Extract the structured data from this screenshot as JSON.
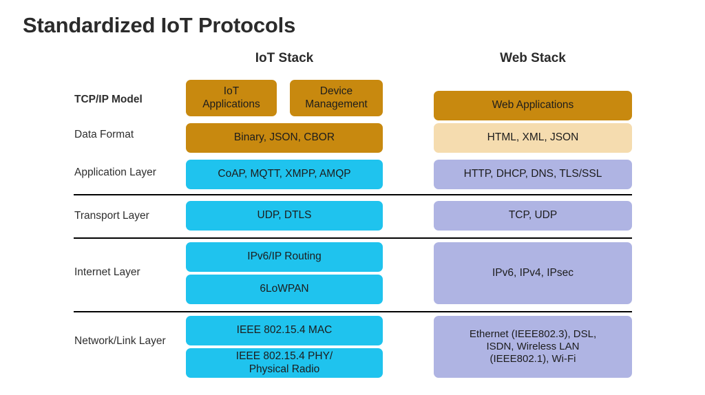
{
  "title": "Standardized IoT Protocols",
  "columns": {
    "iot": "IoT Stack",
    "web": "Web Stack"
  },
  "colors": {
    "orange": "#C8890F",
    "cyan": "#1FC3EE",
    "periwinkle": "#AFB4E3",
    "tan": "#F5DCAF",
    "text": "#1c1c1c",
    "title": "#2b2b2b",
    "divider": "#000000",
    "background": "#ffffff"
  },
  "rows": [
    {
      "label": "TCP/IP Model",
      "iot": [
        "IoT Applications",
        "Device Management"
      ],
      "web": [
        "Web Applications"
      ]
    },
    {
      "label": "Data Format",
      "iot": [
        "Binary, JSON, CBOR"
      ],
      "web": [
        "HTML, XML, JSON"
      ]
    },
    {
      "label": "Application Layer",
      "iot": [
        "CoAP, MQTT, XMPP, AMQP"
      ],
      "web": [
        "HTTP, DHCP, DNS, TLS/SSL"
      ]
    },
    {
      "label": "Transport Layer",
      "iot": [
        "UDP, DTLS"
      ],
      "web": [
        "TCP, UDP"
      ]
    },
    {
      "label": "Internet Layer",
      "iot": [
        "IPv6/IP Routing",
        "6LoWPAN"
      ],
      "web": [
        "IPv6, IPv4, IPsec"
      ]
    },
    {
      "label": "Network/Link Layer",
      "iot": [
        "IEEE 802.15.4 MAC",
        "IEEE 802.15.4 PHY/ Physical Radio"
      ],
      "web": [
        "Ethernet (IEEE802.3), DSL, ISDN, Wireless LAN (IEEE802.1), Wi-Fi"
      ]
    }
  ],
  "box_text": {
    "iot_applications": "IoT\nApplications",
    "device_management": "Device\nManagement",
    "binary_json_cbor": "Binary, JSON, CBOR",
    "coap_mqtt_xmpp_amqp": "CoAP, MQTT, XMPP, AMQP",
    "udp_dtls": "UDP, DTLS",
    "ipv6_ip_routing": "IPv6/IP Routing",
    "sixlowpan": "6LoWPAN",
    "ieee_mac": "IEEE 802.15.4 MAC",
    "ieee_phy": "IEEE 802.15.4 PHY/\nPhysical Radio",
    "web_applications": "Web Applications",
    "html_xml_json": "HTML, XML, JSON",
    "http_dhcp_dns_tls": "HTTP, DHCP, DNS, TLS/SSL",
    "tcp_udp": "TCP, UDP",
    "ipv6_ipv4_ipsec": "IPv6, IPv4, IPsec",
    "ethernet_dsl": "Ethernet (IEEE802.3), DSL,\nISDN, Wireless LAN\n(IEEE802.1), Wi-Fi"
  }
}
